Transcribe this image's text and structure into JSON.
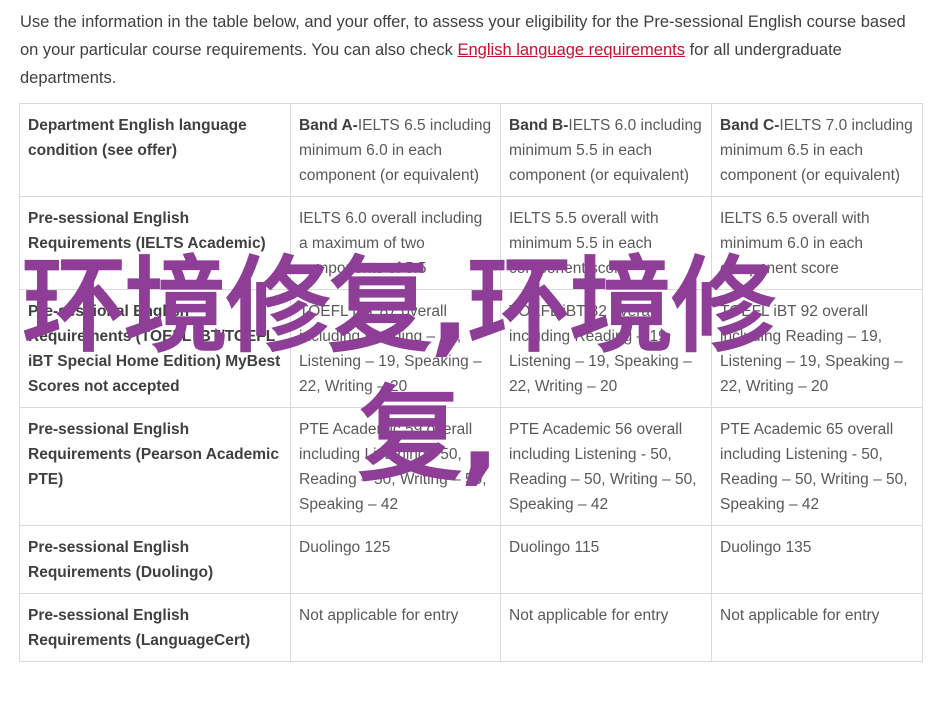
{
  "intro": {
    "text_before": "Use the information in the table below, and your offer, to assess your eligibility for the Pre-sessional English course based on your particular course requirements. You can also check ",
    "link": "English language requirements",
    "text_after": " for all undergraduate departments."
  },
  "table": {
    "rows": [
      {
        "label": "Department English language condition (see offer)",
        "cells": [
          {
            "bold": "Band A-",
            "text": "IELTS 6.5 including minimum 6.0 in each component (or equivalent)"
          },
          {
            "bold": "Band B-",
            "text": "IELTS 6.0 including minimum 5.5 in each component (or equivalent)"
          },
          {
            "bold": "Band C-",
            "text": "IELTS 7.0 including minimum 6.5 in each component (or equivalent)"
          }
        ]
      },
      {
        "label": "Pre-sessional English Requirements (IELTS Academic)",
        "cells": [
          {
            "bold": "",
            "text": "IELTS 6.0 overall including a maximum of two components of 5.5"
          },
          {
            "bold": "",
            "text": "IELTS 5.5 overall with minimum 5.5 in each component score"
          },
          {
            "bold": "",
            "text": "IELTS 6.5 overall with minimum 6.0 in each component score"
          }
        ]
      },
      {
        "label": "Pre-sessional English Requirements (TOEFL iBT/TOEFL iBT Special Home Edition) MyBest Scores not accepted",
        "cells": [
          {
            "bold": "",
            "text": "TOEFL iBT 87 overall including Reading – 19, Listening – 19, Speaking – 22, Writing – 20"
          },
          {
            "bold": "",
            "text": "TOEFL iBT 82 overall including Reading – 19, Listening – 19, Speaking – 22, Writing – 20"
          },
          {
            "bold": "",
            "text": "TOEFL iBT 92 overall including Reading – 19, Listening – 19, Speaking – 22, Writing – 20"
          }
        ]
      },
      {
        "label": "Pre-sessional English Requirements (Pearson Academic PTE)",
        "cells": [
          {
            "bold": "",
            "text": "PTE Academic 59 overall including Listening - 50, Reading – 50, Writing – 50, Speaking – 42"
          },
          {
            "bold": "",
            "text": "PTE Academic 56 overall including Listening - 50, Reading – 50, Writing – 50, Speaking – 42"
          },
          {
            "bold": "",
            "text": "PTE Academic 65 overall including Listening - 50, Reading – 50, Writing – 50, Speaking – 42"
          }
        ]
      },
      {
        "label": "Pre-sessional English Requirements (Duolingo)",
        "cells": [
          {
            "bold": "",
            "text": "Duolingo 125"
          },
          {
            "bold": "",
            "text": "Duolingo 115"
          },
          {
            "bold": "",
            "text": "Duolingo 135"
          }
        ]
      },
      {
        "label": "Pre-sessional English Requirements (LanguageCert)",
        "cells": [
          {
            "bold": "",
            "text": "Not applicable for entry"
          },
          {
            "bold": "",
            "text": "Not applicable for entry"
          },
          {
            "bold": "",
            "text": "Not applicable for entry"
          }
        ]
      }
    ]
  },
  "overlay": {
    "line1": "环境修复,环境修",
    "line2": "复,"
  },
  "colors": {
    "link": "#c8102e",
    "overlay": "#8e3e96",
    "border": "#d9d9d9"
  }
}
